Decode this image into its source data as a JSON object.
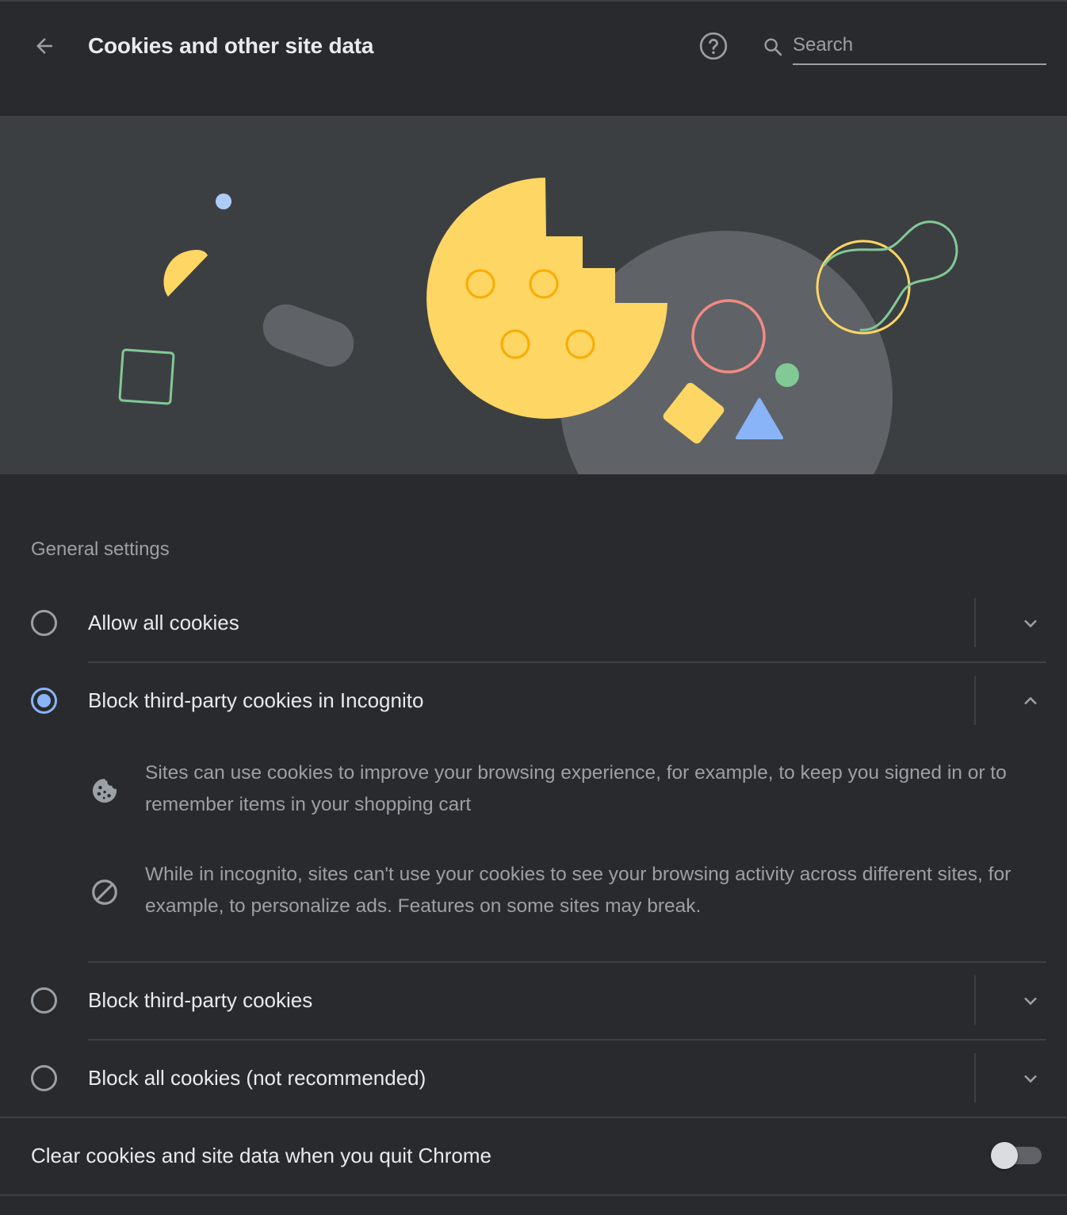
{
  "header": {
    "title": "Cookies and other site data",
    "back_icon": "arrow-back-icon",
    "help_icon": "help-circle-icon",
    "search_placeholder": "Search",
    "search_value": ""
  },
  "banner": {
    "illustration": "cookie-illustration",
    "colors": {
      "cookie": "#fdd663",
      "bite_bg": "#5f6368",
      "red_ring": "#f28b82",
      "green": "#81c995",
      "blue": "#8ab4f8",
      "yellow_outline": "#fdd663"
    }
  },
  "general_settings": {
    "title": "General settings",
    "options": [
      {
        "label": "Allow all cookies",
        "selected": false,
        "expanded": false
      },
      {
        "label": "Block third-party cookies in Incognito",
        "selected": true,
        "expanded": true
      },
      {
        "label": "Block third-party cookies",
        "selected": false,
        "expanded": false
      },
      {
        "label": "Block all cookies (not recommended)",
        "selected": false,
        "expanded": false
      }
    ],
    "details": [
      {
        "icon": "cookie-icon",
        "text": "Sites can use cookies to improve your browsing experience, for example, to keep you signed in or to remember items in your shopping cart"
      },
      {
        "icon": "block-icon",
        "text": "While in incognito, sites can't use your cookies to see your browsing activity across different sites, for example, to personalize ads. Features on some sites may break."
      }
    ]
  },
  "clear_on_quit": {
    "label": "Clear cookies and site data when you quit Chrome",
    "enabled": false
  },
  "colors": {
    "background": "#292a2d",
    "accent": "#8ab4f8",
    "secondary_text": "#9aa0a6",
    "divider": "#3c4043"
  }
}
